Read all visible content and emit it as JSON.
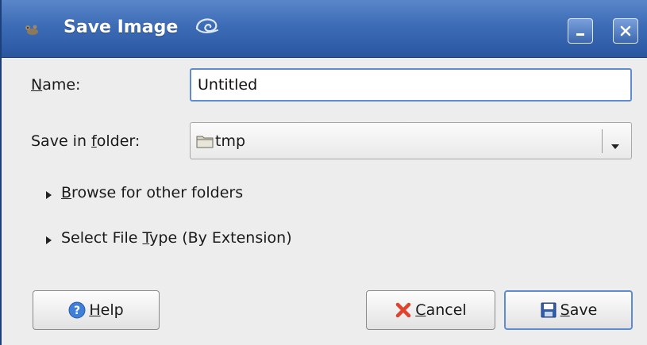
{
  "window": {
    "title": "Save Image",
    "title_bar_color": "#3d6cb6",
    "icons": [
      "gimp-wilber-icon",
      "lizard-icon"
    ],
    "controls": {
      "minimize": "minimize-icon",
      "close": "close-icon"
    }
  },
  "form": {
    "name": {
      "label_mnemonic": "N",
      "label_rest": "ame:",
      "value": "Untitled"
    },
    "folder": {
      "label_pre": "Save in ",
      "label_mnemonic": "f",
      "label_rest": "older:",
      "value": "tmp",
      "icon": "folder-icon"
    }
  },
  "expanders": {
    "browse": {
      "pre": "",
      "mnemonic": "B",
      "rest": "rowse for other folders"
    },
    "filetype": {
      "pre": "Select File ",
      "mnemonic": "T",
      "rest": "ype (By Extension)"
    }
  },
  "buttons": {
    "help": {
      "mnemonic": "H",
      "rest": "elp",
      "icon": "help-icon"
    },
    "cancel": {
      "mnemonic": "C",
      "rest": "ancel",
      "icon": "cancel-x-icon"
    },
    "save": {
      "mnemonic": "S",
      "rest": "ave",
      "icon": "floppy-disk-icon"
    }
  }
}
